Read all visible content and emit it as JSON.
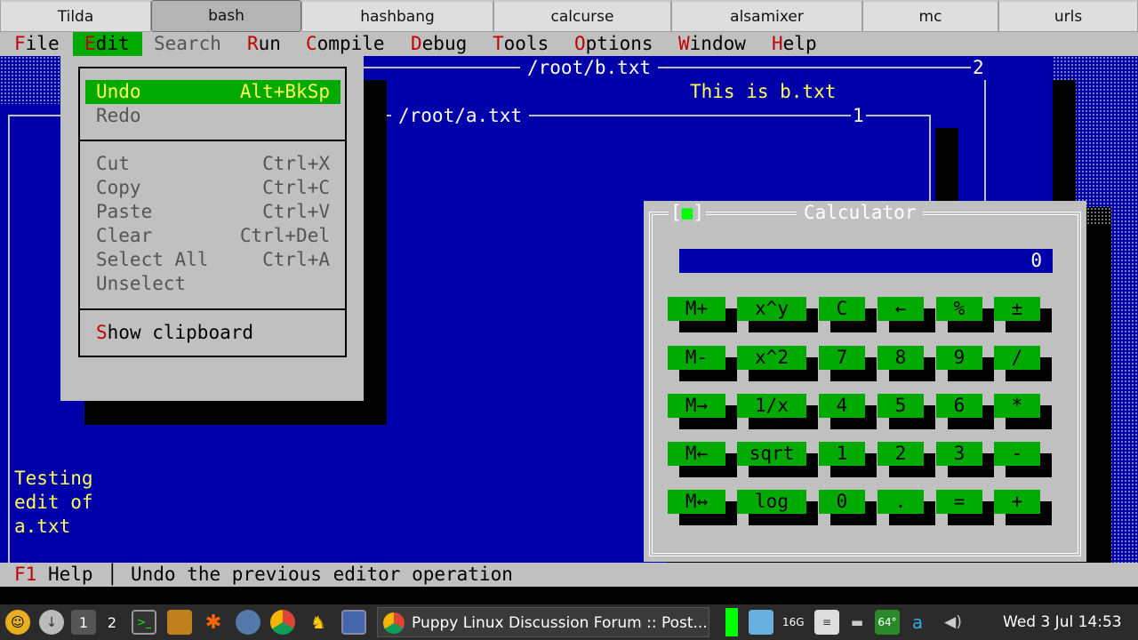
{
  "tabs": [
    "Tilda",
    "bash",
    "hashbang",
    "calcurse",
    "alsamixer",
    "mc",
    "urls"
  ],
  "menubar": {
    "items": [
      {
        "hk": "F",
        "rest": "ile"
      },
      {
        "hk": "E",
        "rest": "dit"
      },
      {
        "hk": "",
        "rest": "Search"
      },
      {
        "hk": "R",
        "rest": "un"
      },
      {
        "hk": "C",
        "rest": "ompile"
      },
      {
        "hk": "D",
        "rest": "ebug"
      },
      {
        "hk": "T",
        "rest": "ools"
      },
      {
        "hk": "O",
        "rest": "ptions"
      },
      {
        "hk": "W",
        "rest": "indow"
      },
      {
        "hk": "H",
        "rest": "elp"
      }
    ]
  },
  "windows": {
    "b": {
      "title": "/root/b.txt",
      "number": "2",
      "text": "This is b.txt"
    },
    "a": {
      "title": "/root/a.txt",
      "number": "1",
      "text_lines": [
        "Testing",
        "edit of",
        "a.txt"
      ]
    }
  },
  "edit_menu": {
    "items": [
      {
        "label": "Undo",
        "accel": "Alt+BkSp"
      },
      {
        "label": "Redo",
        "accel": ""
      },
      {
        "label": "Cut",
        "accel": "Ctrl+X"
      },
      {
        "label": "Copy",
        "accel": "Ctrl+C"
      },
      {
        "label": "Paste",
        "accel": "Ctrl+V"
      },
      {
        "label": "Clear",
        "accel": "Ctrl+Del"
      },
      {
        "label": "Select All",
        "accel": "Ctrl+A"
      },
      {
        "label": "Unselect",
        "accel": ""
      }
    ],
    "clipboard": {
      "hk": "S",
      "rest": "how clipboard"
    }
  },
  "calculator": {
    "title": "Calculator",
    "close_open": "[",
    "close_mark": "■",
    "close_close": "]",
    "display": "0",
    "rows": [
      [
        "M+",
        "x^y",
        "C",
        "←",
        "%",
        "±"
      ],
      [
        "M-",
        "x^2",
        "7",
        "8",
        "9",
        "/"
      ],
      [
        "M→",
        "1/x",
        "4",
        "5",
        "6",
        "*"
      ],
      [
        "M←",
        "sqrt",
        "1",
        "2",
        "3",
        "-"
      ],
      [
        "M↔",
        "log",
        "0",
        ".",
        "=",
        "+"
      ]
    ]
  },
  "status": {
    "hk": "F1",
    "help": " Help",
    "sep": "│",
    "message": "Undo the previous editor operation"
  },
  "taskbar": {
    "workspace_1": "1",
    "workspace_2": "2",
    "task_label": "Puppy Linux Discussion Forum :: Post...",
    "mem": "16G",
    "temp": "64°",
    "letter": "a",
    "clock": "Wed 3 Jul 14:53",
    "colors": {
      "bg": "#2b2b2b",
      "green": "#00ff00"
    }
  },
  "colors": {
    "blue": "#0000aa",
    "gray": "#c0c0c0",
    "green": "#00aa00",
    "yellow": "#ffff55",
    "red": "#c00000"
  }
}
